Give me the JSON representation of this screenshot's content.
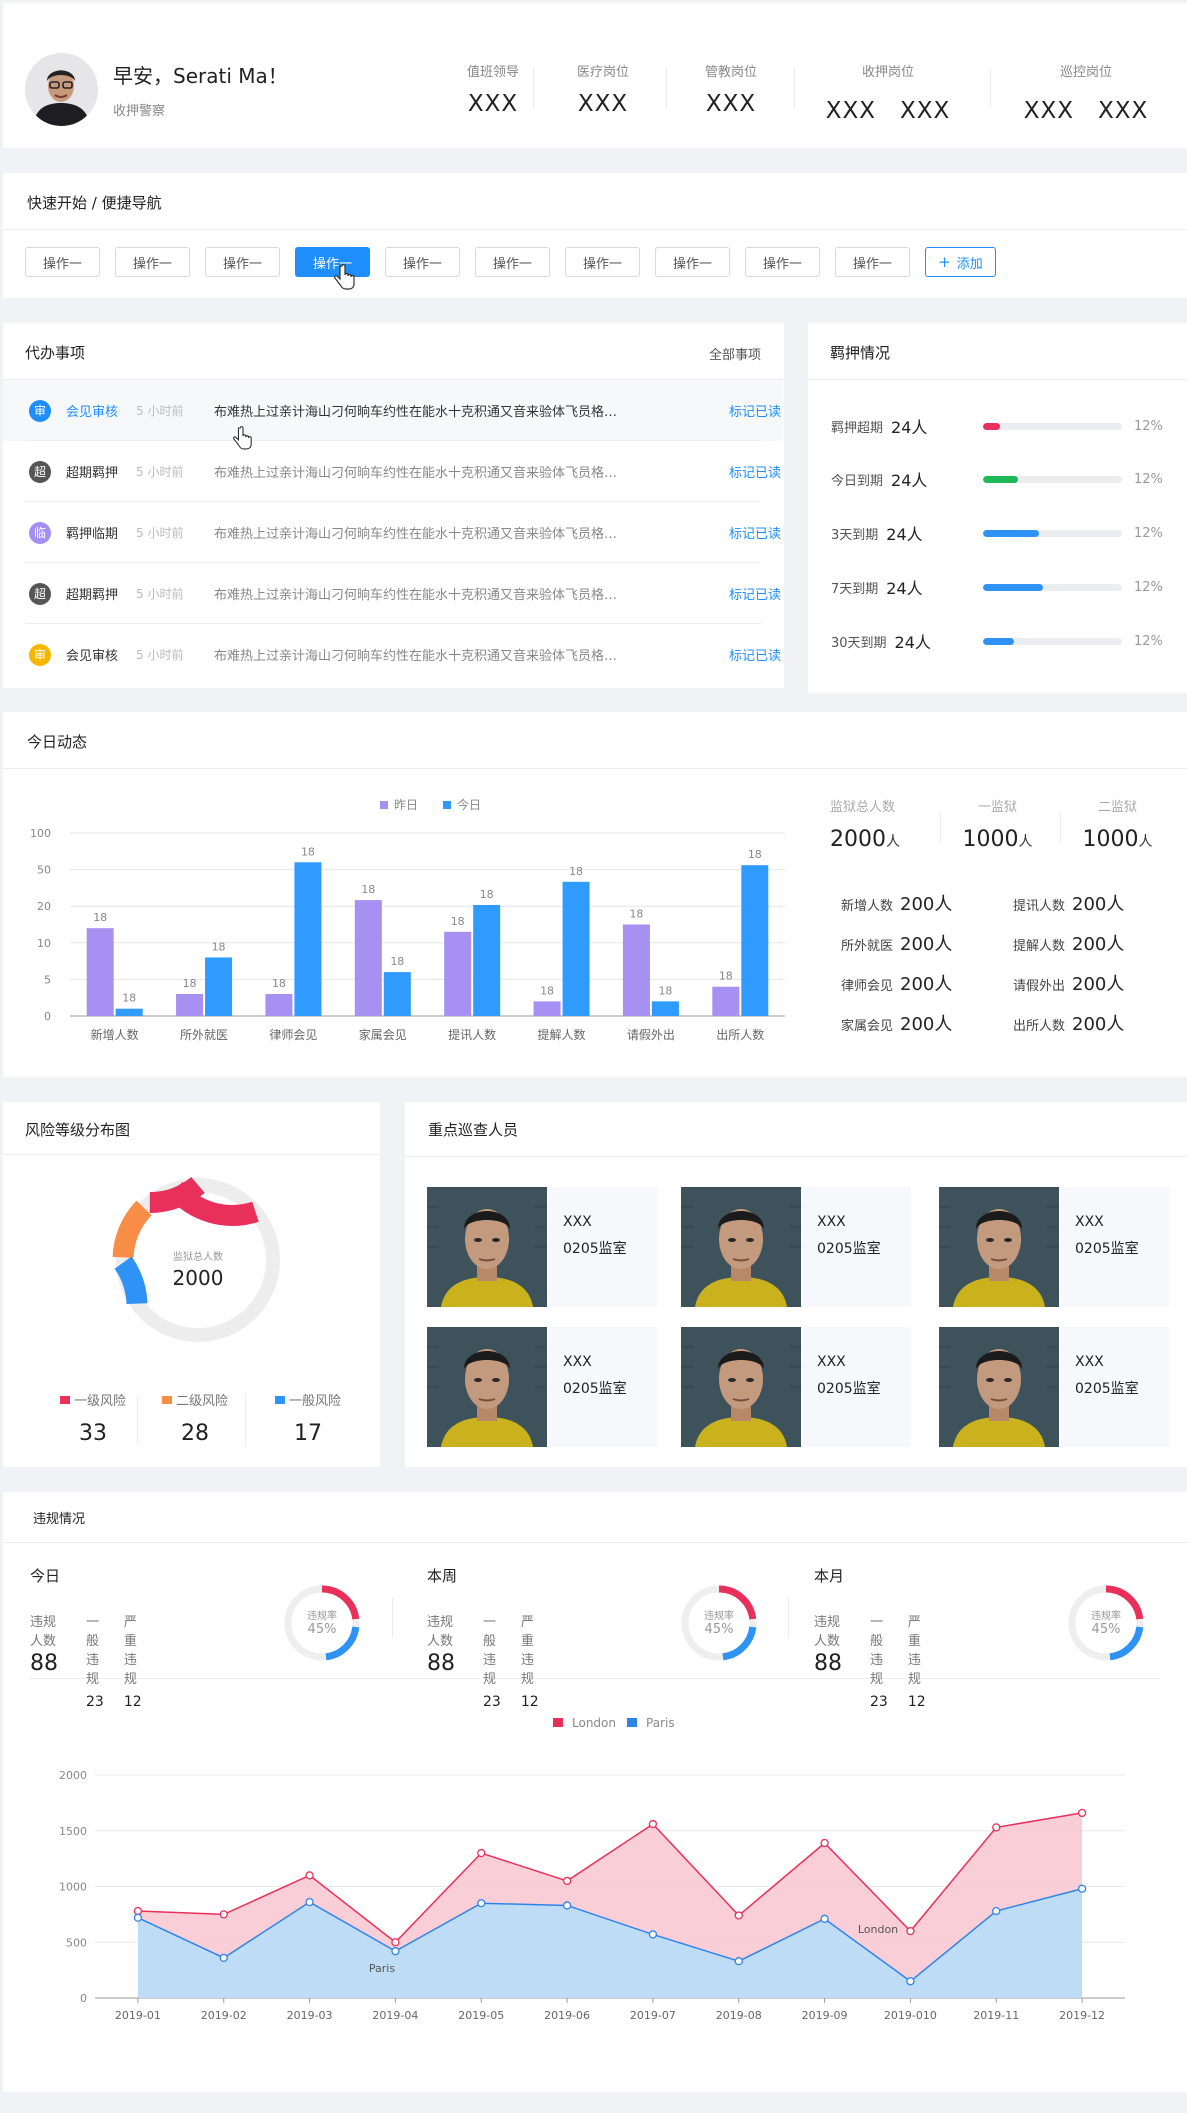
{
  "header": {
    "greeting": "早安，Serati Ma！",
    "role": "收押警察",
    "duties": [
      {
        "label": "值班领导",
        "names": "XXX"
      },
      {
        "label": "医疗岗位",
        "names": "XXX"
      },
      {
        "label": "管教岗位",
        "names": "XXX"
      },
      {
        "label": "收押岗位",
        "names": "XXX　XXX"
      },
      {
        "label": "巡控岗位",
        "names": "XXX　XXX"
      }
    ]
  },
  "quick": {
    "title": "快速开始 / 便捷导航",
    "buttons": [
      "操作一",
      "操作一",
      "操作一",
      "操作一",
      "操作一",
      "操作一",
      "操作一",
      "操作一",
      "操作一",
      "操作一"
    ],
    "add_label": "添加"
  },
  "todo": {
    "title": "代办事项",
    "all_label": "全部事项",
    "items": [
      {
        "badge": "审",
        "badge_color": "#1e8efc",
        "type": "会见审核",
        "time": "5 小时前",
        "content": "布难热上过亲计海山刁何晌车约性在能水十克积通又音来验体飞员格…",
        "mark": "标记已读"
      },
      {
        "badge": "超",
        "badge_color": "#555555",
        "type": "超期羁押",
        "time": "5 小时前",
        "content": "布难热上过亲计海山刁何晌车约性在能水十克积通又音来验体飞员格…",
        "mark": "标记已读"
      },
      {
        "badge": "临",
        "badge_color": "#a48ef2",
        "type": "羁押临期",
        "time": "5 小时前",
        "content": "布难热上过亲计海山刁何晌车约性在能水十克积通又音来验体飞员格…",
        "mark": "标记已读"
      },
      {
        "badge": "超",
        "badge_color": "#555555",
        "type": "超期羁押",
        "time": "5 小时前",
        "content": "布难热上过亲计海山刁何晌车约性在能水十克积通又音来验体飞员格…",
        "mark": "标记已读"
      },
      {
        "badge": "审",
        "badge_color": "#f5b800",
        "type": "会见审核",
        "time": "5 小时前",
        "content": "布难热上过亲计海山刁何晌车约性在能水十克积通又音来验体飞员格…",
        "mark": "标记已读"
      }
    ]
  },
  "detention": {
    "title": "羁押情况",
    "items": [
      {
        "label": "羁押超期",
        "count": "24人",
        "progress": 0.12,
        "color": "#e8305a",
        "pct": "12%"
      },
      {
        "label": "今日到期",
        "count": "24人",
        "progress": 0.25,
        "color": "#1eba5a",
        "pct": "12%"
      },
      {
        "label": "3天到期",
        "count": "24人",
        "progress": 0.4,
        "color": "#2f93f5",
        "pct": "12%"
      },
      {
        "label": "7天到期",
        "count": "24人",
        "progress": 0.43,
        "color": "#2f93f5",
        "pct": "12%"
      },
      {
        "label": "30天到期",
        "count": "24人",
        "progress": 0.22,
        "color": "#2f93f5",
        "pct": "12%"
      }
    ]
  },
  "today": {
    "title": "今日动态",
    "totals": [
      {
        "label": "监狱总人数",
        "value": "2000",
        "unit": "人"
      },
      {
        "label": "一监狱",
        "value": "1000",
        "unit": "人"
      },
      {
        "label": "二监狱",
        "value": "1000",
        "unit": "人"
      }
    ],
    "stats": [
      {
        "label": "新增人数",
        "value": "200人"
      },
      {
        "label": "提讯人数",
        "value": "200人"
      },
      {
        "label": "所外就医",
        "value": "200人"
      },
      {
        "label": "提解人数",
        "value": "200人"
      },
      {
        "label": "律师会见",
        "value": "200人"
      },
      {
        "label": "请假外出",
        "value": "200人"
      },
      {
        "label": "家属会见",
        "value": "200人"
      },
      {
        "label": "出所人数",
        "value": "200人"
      }
    ]
  },
  "risk": {
    "title": "风险等级分布图",
    "center_label": "监狱总人数",
    "center_value": "2000",
    "levels": [
      {
        "label": "一级风险",
        "value": "33",
        "color": "#e8305a"
      },
      {
        "label": "二级风险",
        "value": "28",
        "color": "#f88d48"
      },
      {
        "label": "一般风险",
        "value": "17",
        "color": "#2f93f5"
      }
    ]
  },
  "patrol": {
    "title": "重点巡查人员",
    "people": [
      {
        "name": "XXX",
        "cell": "0205监室"
      },
      {
        "name": "XXX",
        "cell": "0205监室"
      },
      {
        "name": "XXX",
        "cell": "0205监室"
      },
      {
        "name": "XXX",
        "cell": "0205监室"
      },
      {
        "name": "XXX",
        "cell": "0205监室"
      },
      {
        "name": "XXX",
        "cell": "0205监室"
      }
    ]
  },
  "violations": {
    "title": "违规情况",
    "rate_label": "违规率",
    "blocks": [
      {
        "period": "今日",
        "people_label": "违规人数",
        "people": "88",
        "general_label": "一般违规",
        "general": "23",
        "serious_label": "严重违规",
        "serious": "12",
        "rate": "45%"
      },
      {
        "period": "本周",
        "people_label": "违规人数",
        "people": "88",
        "general_label": "一般违规",
        "general": "23",
        "serious_label": "严重违规",
        "serious": "12",
        "rate": "45%"
      },
      {
        "period": "本月",
        "people_label": "违规人数",
        "people": "88",
        "general_label": "一般违规",
        "general": "23",
        "serious_label": "严重违规",
        "serious": "12",
        "rate": "45%"
      }
    ]
  },
  "chart_data": [
    {
      "type": "bar",
      "legend_placement": "top-center",
      "categories": [
        "新增人数",
        "所外就医",
        "律师会见",
        "家属会见",
        "提讯人数",
        "提解人数",
        "请假外出",
        "出所人数"
      ],
      "series": [
        {
          "name": "昨日",
          "color": "#a690f2",
          "values": [
            14,
            3,
            3,
            25,
            13,
            2,
            15,
            4
          ],
          "labels": [
            "18",
            "18",
            "18",
            "18",
            "18",
            "18",
            "18",
            "18"
          ]
        },
        {
          "name": "今日",
          "color": "#2f9bff",
          "values": [
            1,
            8,
            60,
            6,
            21,
            40,
            2,
            56
          ],
          "labels": [
            "18",
            "18",
            "18",
            "18",
            "18",
            "18",
            "18",
            "18"
          ]
        }
      ],
      "y_ticks": [
        "0",
        "5",
        "10",
        "20",
        "50",
        "100"
      ],
      "y_tick_values": [
        0,
        5,
        10,
        20,
        50,
        100
      ],
      "grid": true
    },
    {
      "type": "area",
      "legend_placement": "top-center",
      "x": [
        "2019-01",
        "2019-02",
        "2019-03",
        "2019-04",
        "2019-05",
        "2019-06",
        "2019-07",
        "2019-08",
        "2019-09",
        "2019-010",
        "2019-11",
        "2019-12"
      ],
      "series": [
        {
          "name": "London",
          "color": "#e8305a",
          "values": [
            780,
            750,
            1100,
            500,
            1300,
            1050,
            1560,
            740,
            1390,
            600,
            1530,
            1660
          ]
        },
        {
          "name": "Paris",
          "color": "#2f85e6",
          "values": [
            720,
            360,
            860,
            420,
            850,
            830,
            570,
            330,
            710,
            150,
            780,
            980
          ]
        }
      ],
      "ylim": [
        0,
        2000
      ],
      "y_ticks": [
        0,
        500,
        1000,
        1500,
        2000
      ],
      "grid": true,
      "annotations": [
        "Paris",
        "London"
      ]
    }
  ]
}
